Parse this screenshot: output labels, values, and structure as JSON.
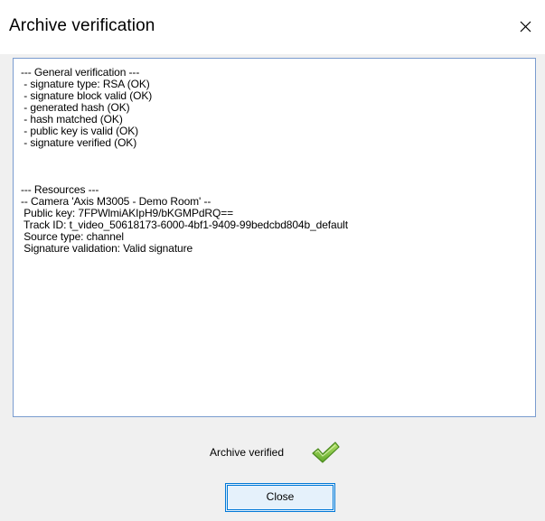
{
  "window": {
    "title": "Archive verification",
    "close_icon": "close-icon"
  },
  "log": {
    "lines": [
      "--- General verification ---",
      " - signature type: RSA (OK)",
      " - signature block valid (OK)",
      " - generated hash (OK)",
      " - hash matched (OK)",
      " - public key is valid (OK)",
      " - signature verified (OK)",
      "",
      "",
      "",
      "--- Resources ---",
      "-- Camera 'Axis M3005 - Demo Room' --",
      " Public key: 7FPWlmiAKIpH9/bKGMPdRQ==",
      " Track ID: t_video_50618173-6000-4bf1-9409-99bedcbd804b_default",
      " Source type: channel",
      " Signature validation: Valid signature"
    ]
  },
  "status": {
    "text": "Archive verified",
    "icon": "checkmark-icon",
    "icon_color": "#7cc242"
  },
  "buttons": {
    "close_label": "Close"
  },
  "colors": {
    "accent": "#0078d7",
    "textbox_border": "#7a9ccf",
    "dialog_background": "#f0f0f0"
  }
}
